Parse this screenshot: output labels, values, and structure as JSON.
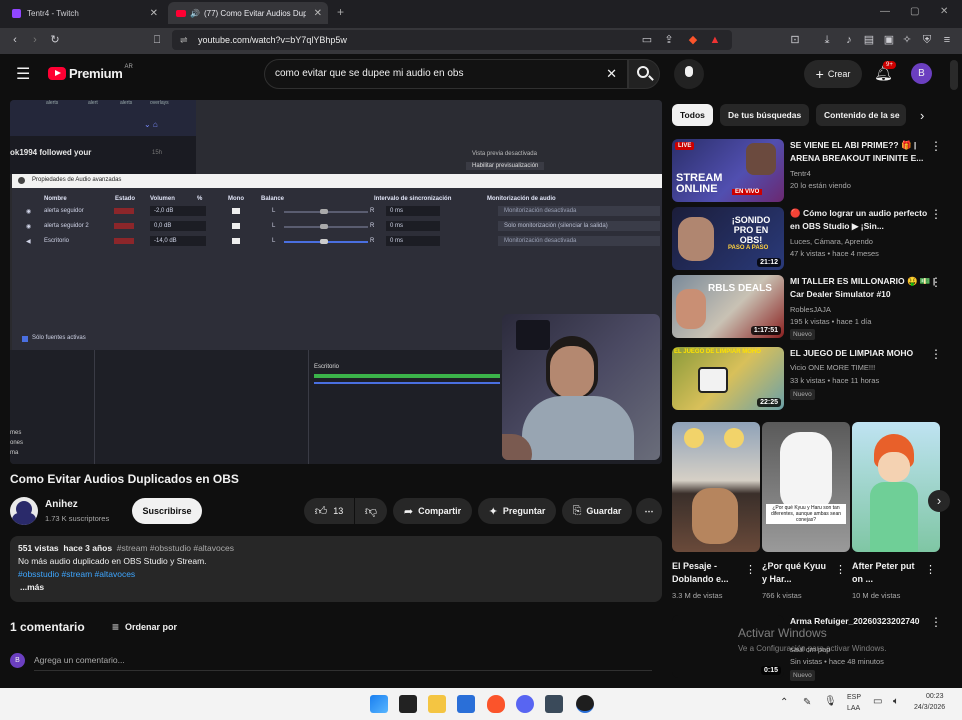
{
  "browser": {
    "tabs": [
      {
        "title": "Tentr4 - Twitch"
      },
      {
        "title": "(77) Como Evitar Audios Dupl"
      }
    ],
    "url": "youtube.com/watch?v=bY7qlYBhp5w"
  },
  "youtube": {
    "logo_text": "Premium",
    "logo_region": "AR",
    "search_value": "como evitar que se dupee mi audio en obs",
    "create_label": "Crear",
    "notif_count": "9+",
    "avatar_letter": "B"
  },
  "video_frame": {
    "follow_text": "ok1994 followed your",
    "follow_side": "15h",
    "preview_label": "Vista previa desactivada",
    "enable_preview": "Habilitar previsualización",
    "dialog_title": "Propiedades de Audio avanzadas",
    "columns": [
      "Nombre",
      "Estado",
      "Volumen",
      "%",
      "Mono",
      "Balance",
      "Intervalo de sincronización",
      "Monitorización de audio"
    ],
    "rows": [
      {
        "name": "alerta seguidor",
        "vol": "-2,0 dB",
        "sync": "0 ms",
        "monitor": "Monitorización desactivada"
      },
      {
        "name": "alerta seguidor 2",
        "vol": "0,0 dB",
        "sync": "0 ms",
        "monitor": "Solo monitorización (silenciar la salida)"
      },
      {
        "name": "Escritorio",
        "vol": "-14,0 dB",
        "sync": "0 ms",
        "monitor": "Monitorización desactivada"
      }
    ],
    "active_only": "Sólo fuentes activas",
    "mixer_label": "Escritorio",
    "top_labels": [
      "alerts",
      "alert",
      "alerts",
      "overlays"
    ],
    "left_labels": [
      "mes",
      "ones",
      "ma"
    ]
  },
  "video": {
    "title": "Como Evitar Audios Duplicados en OBS",
    "channel": "Anihez",
    "subscribers": "1.73 K suscriptores",
    "subscribe_label": "Suscribirse",
    "likes": "13",
    "share_label": "Compartir",
    "ask_label": "Preguntar",
    "save_label": "Guardar",
    "views": "551 vistas",
    "age": "hace 3 años",
    "hashtags_top": "#stream #obsstudio #altavoces",
    "desc_line": "No más audio duplicado en OBS Studio y Stream.",
    "hashtags_bottom": "#obsstudio #stream #altavoces",
    "more": "...más"
  },
  "comments": {
    "count_label": "1 comentario",
    "sort_label": "Ordenar por",
    "placeholder": "Agrega un comentario...",
    "avatar_letter": "B"
  },
  "chips": [
    "Todos",
    "De tus búsquedas",
    "Contenido de la se"
  ],
  "recommendations": [
    {
      "title": "SE VIENE EL ABI PRIME?? 🎁 | ARENA BREAKOUT INFINITE E...",
      "channel": "Tentr4",
      "meta": "20 lo están viendo",
      "live": "LIVE",
      "thumb_text": "STREAM ONLINE",
      "thumb_sub": "EN VIVO"
    },
    {
      "title": "🔴 Cómo lograr un audio perfecto en OBS Studio ▶ ¡Sin...",
      "channel": "Luces, Cámara, Aprendo",
      "meta": "47 k vistas • hace 4 meses",
      "duration": "21:12",
      "thumb_text": "¡SONIDO PRO EN OBS!",
      "thumb_sub": "PASO A PASO"
    },
    {
      "title": "MI TALLER ES MILLONARIO 🤑 💵 | Car Dealer Simulator #10",
      "channel": "RoblesJAJA",
      "meta": "195 k vistas • hace 1 día",
      "duration": "1:17:51",
      "badge": "Nuevo",
      "thumb_text": "RBLS DEALS"
    },
    {
      "title": "EL JUEGO DE LIMPIAR MOHO",
      "channel": "Vicio ONE MORE TIME!!!",
      "meta": "33 k vistas • hace 11 horas",
      "duration": "22:25",
      "badge": "Nuevo",
      "thumb_text": "EL JUEGO DE LIMPIAR MOHO"
    }
  ],
  "shorts": [
    {
      "title": "El Pesaje - Doblando e...",
      "views": "3.3 M de vistas"
    },
    {
      "title": "¿Por qué Kyuu y Har...",
      "views": "766 k vistas",
      "thumb_text": "¿Por qué Kyuu y Haru son tan diferentes, aunque ambas sean conejas?"
    },
    {
      "title": "After Peter put on ...",
      "views": "10 M de vistas"
    }
  ],
  "last_rec": {
    "title": "Arma Refuiger_20260323202740",
    "channel": "saul cm pap",
    "meta": "Sin vistas • hace 48 minutos",
    "duration": "0:15",
    "badge": "Nuevo"
  },
  "watermark": {
    "line1": "Activar Windows",
    "line2": "Ve a Configuración para activar Windows."
  },
  "taskbar": {
    "lang": "ESP",
    "lang2": "LAA",
    "time": "00:23",
    "date": "24/3/2026"
  },
  "colors": {
    "yt_red": "#ff0033",
    "bg": "#0f0f0f",
    "link_blue": "#3ea6ff"
  }
}
